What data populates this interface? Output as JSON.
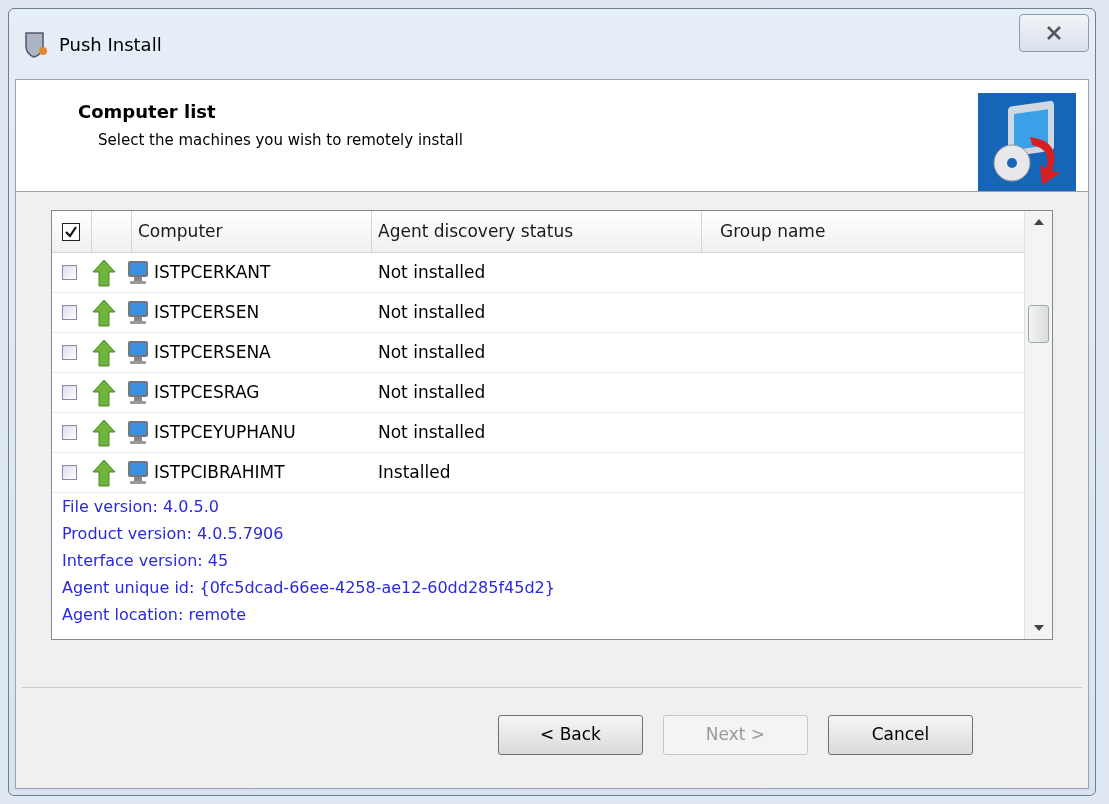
{
  "window": {
    "title": "Push Install"
  },
  "header": {
    "title": "Computer list",
    "subtitle": "Select the machines you wish to remotely install"
  },
  "table": {
    "select_all_checked": true,
    "columns": [
      "Computer",
      "Agent discovery status",
      "Group name"
    ],
    "rows": [
      {
        "computer": "ISTPCERKANT",
        "status": "Not installed",
        "checked": false
      },
      {
        "computer": "ISTPCERSEN",
        "status": "Not installed",
        "checked": false
      },
      {
        "computer": "ISTPCERSENA",
        "status": "Not installed",
        "checked": false
      },
      {
        "computer": "ISTPCESRAG",
        "status": "Not installed",
        "checked": false
      },
      {
        "computer": "ISTPCEYUPHANU",
        "status": "Not installed",
        "checked": false
      },
      {
        "computer": "ISTPCIBRAHIMT",
        "status": "Installed",
        "checked": false,
        "details": [
          "File version: 4.0.5.0",
          "Product version: 4.0.5.7906",
          "Interface version: 45",
          "Agent unique id: {0fc5dcad-66ee-4258-ae12-60dd285f45d2}",
          "Agent location: remote"
        ]
      }
    ]
  },
  "buttons": [
    {
      "label": "< Back",
      "disabled": false
    },
    {
      "label": "Next >",
      "disabled": true
    },
    {
      "label": "Cancel",
      "disabled": false
    }
  ]
}
